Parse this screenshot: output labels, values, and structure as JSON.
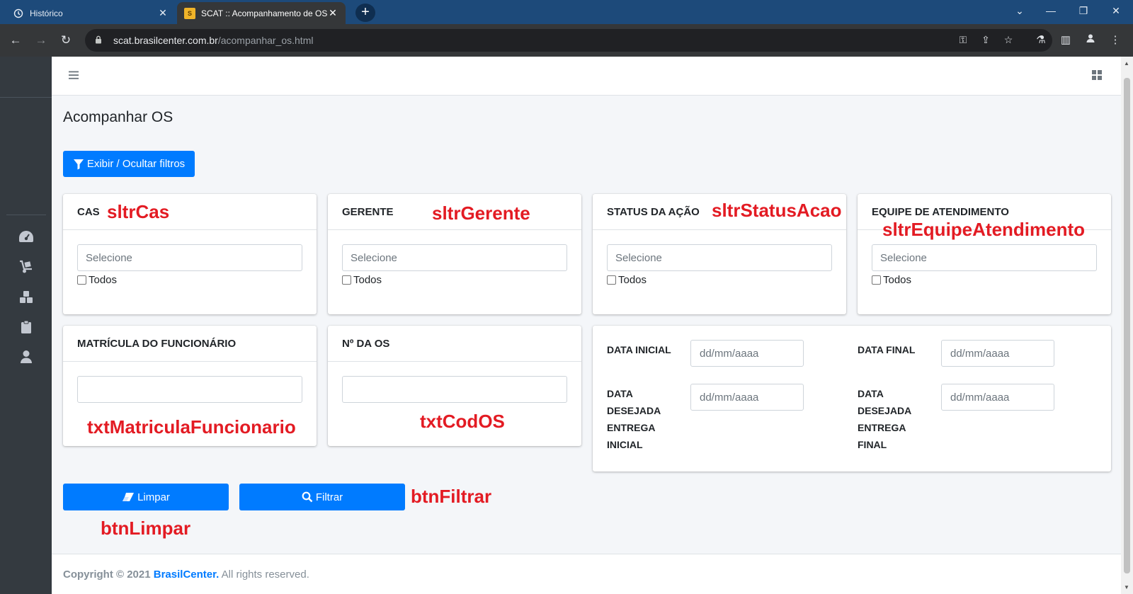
{
  "browser": {
    "tabs": [
      {
        "title": "Histórico",
        "active": false
      },
      {
        "title": "SCAT :: Acompanhamento de OS",
        "active": true
      }
    ],
    "url_host": "scat.brasilcenter.com.br",
    "url_path": "/acompanhar_os.html"
  },
  "page": {
    "title": "Acompanhar OS",
    "toggle_filters_label": "Exibir / Ocultar filtros"
  },
  "filters": {
    "cas": {
      "title": "CAS",
      "placeholder": "Selecione",
      "check_label": "Todos",
      "annotation": "sltrCas"
    },
    "gerente": {
      "title": "GERENTE",
      "placeholder": "Selecione",
      "check_label": "Todos",
      "annotation": "sltrGerente"
    },
    "status": {
      "title": "STATUS DA AÇÃO",
      "placeholder": "Selecione",
      "check_label": "Todos",
      "annotation": "sltrStatusAcao"
    },
    "equipe": {
      "title": "EQUIPE DE ATENDIMENTO",
      "placeholder": "Selecione",
      "check_label": "Todos",
      "annotation": "sltrEquipeAtendimento"
    },
    "matricula": {
      "title": "MATRÍCULA DO FUNCIONÁRIO",
      "value": "",
      "annotation": "txtMatriculaFuncionario"
    },
    "num_os": {
      "title": "Nº DA OS",
      "value": "",
      "annotation": "txtCodOS"
    }
  },
  "dates": {
    "inicial_label": "DATA INICIAL",
    "final_label": "DATA FINAL",
    "desejada_inicial_label": [
      "DATA",
      "DESEJADA",
      "ENTREGA",
      "INICIAL"
    ],
    "desejada_final_label": [
      "DATA",
      "DESEJADA",
      "ENTREGA",
      "FINAL"
    ],
    "placeholder": "dd/mm/aaaa"
  },
  "actions": {
    "limpar_label": "Limpar",
    "filtrar_label": "Filtrar",
    "limpar_annotation": "btnLimpar",
    "filtrar_annotation": "btnFiltrar"
  },
  "footer": {
    "copyright": "Copyright © 2021",
    "brand": "BrasilCenter.",
    "rights": "All rights reserved."
  },
  "colors": {
    "primary": "#007bff",
    "annotation": "#e31b23",
    "sidebar": "#343a40"
  }
}
